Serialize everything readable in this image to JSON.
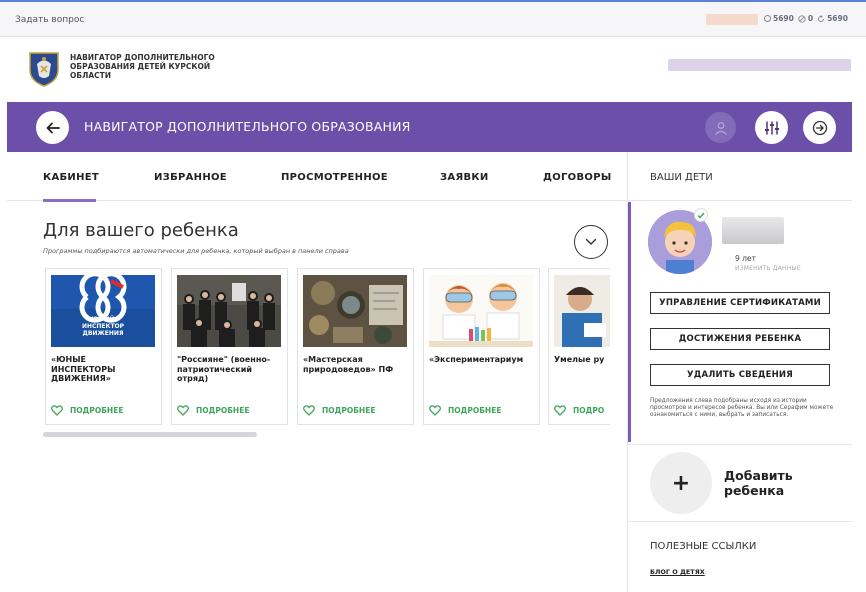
{
  "topbar": {
    "ask_label": "Задать вопрос",
    "stats": [
      {
        "icon": "circle-icon",
        "value": "5690"
      },
      {
        "icon": "ban-icon",
        "value": "0"
      },
      {
        "icon": "refresh-icon",
        "value": "5690"
      }
    ]
  },
  "header": {
    "brand_text": "НАВИГАТОР ДОПОЛНИТЕЛЬНОГО ОБРАЗОВАНИЯ ДЕТЕЙ КУРСКОЙ ОБЛАСТИ"
  },
  "navbar": {
    "title": "НАВИГАТОР ДОПОЛНИТЕЛЬНОГО ОБРАЗОВАНИЯ",
    "bg_color": "#6b4fa8"
  },
  "tabs": [
    {
      "label": "КАБИНЕТ",
      "active": true
    },
    {
      "label": "ИЗБРАННОЕ"
    },
    {
      "label": "ПРОСМОТРЕННОЕ"
    },
    {
      "label": "ЗАЯВКИ"
    },
    {
      "label": "ДОГОВОРЫ"
    }
  ],
  "section": {
    "title": "Для вашего ребенка",
    "subtitle": "Программы подбираются автоматически для ребенка, который выбран в панели справа"
  },
  "cards": [
    {
      "title": "«ЮНЫЕ\nИНСПЕКТОРЫ\nДВИЖЕНИЯ»",
      "more": "ПОДРОБНЕЕ",
      "image_text": "ЮНЫЙ\nИНСПЕКТОР\nДВИЖЕНИЯ"
    },
    {
      "title": "\"Россияне\" (военно-\nпатриотический\nотряд)",
      "more": "ПОДРОБНЕЕ"
    },
    {
      "title": "«Мастерская\nприродоведов» ПФ",
      "more": "ПОДРОБНЕЕ"
    },
    {
      "title": "«Экспериментариум",
      "more": "ПОДРОБНЕЕ"
    },
    {
      "title": "Умелые ру",
      "more": "ПОДРО"
    }
  ],
  "right": {
    "heading": "ВАШИ ДЕТИ",
    "age": "9 лет",
    "edit_label": "ИЗМЕНИТЬ ДАННЫЕ",
    "buttons": [
      "УПРАВЛЕНИЕ СЕРТИФИКАТАМИ",
      "ДОСТИЖЕНИЯ РЕБЕНКА",
      "УДАЛИТЬ СВЕДЕНИЯ"
    ],
    "note": "Предложения слева подобраны исходя из истории просмотров и интересов ребенка. Вы или Серафим можете ознакомиться с ними, выбрать и записаться.",
    "add_label": "Добавить\nребенка",
    "useful_heading": "ПОЛЕЗНЫЕ ССЫЛКИ",
    "blog_link": "БЛОГ О ДЕТЯХ"
  }
}
